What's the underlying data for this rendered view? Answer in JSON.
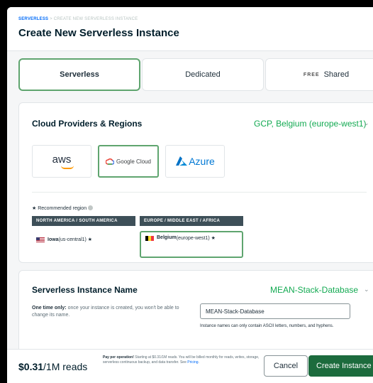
{
  "breadcrumb": {
    "parent": "SERVERLESS",
    "separator": " > ",
    "current": "CREATE NEW SERVERLESS INSTANCE"
  },
  "page_title": "Create New Serverless Instance",
  "tabs": [
    {
      "label": "Serverless",
      "selected": true
    },
    {
      "label": "Dedicated",
      "selected": false
    },
    {
      "badge": "FREE",
      "label": "Shared",
      "selected": false
    }
  ],
  "cloud": {
    "title": "Cloud Providers & Regions",
    "summary": "GCP, Belgium (europe-west1)",
    "providers": [
      {
        "name": "aws",
        "label": "aws",
        "selected": false
      },
      {
        "name": "google-cloud",
        "label": "Google Cloud",
        "selected": true
      },
      {
        "name": "azure",
        "label": "Azure",
        "selected": false
      }
    ],
    "recommended_label": "★ Recommended region",
    "region_groups": [
      {
        "header": "NORTH AMERICA / SOUTH AMERICA",
        "region": "Iowa",
        "code": " (us-central1) ★",
        "selected": false
      },
      {
        "header": "EUROPE / MIDDLE EAST / AFRICA",
        "region": "Belgium",
        "code": " (europe-west1) ★",
        "selected": true
      }
    ]
  },
  "instance_name": {
    "title": "Serverless Instance Name",
    "summary": "MEAN-Stack-Database",
    "note_strong": "One time only:",
    "note_rest": " once your instance is created, you won't be able to change its name.",
    "value": "MEAN-Stack-Database",
    "hint": "Instance names can only contain ASCII letters, numbers, and hyphens."
  },
  "footer": {
    "price": "$0.31",
    "price_unit": "/1M reads",
    "pay_strong": "Pay per operation!",
    "pay_text": " Starting at $0.31/1M reads. You will be billed monthly for reads, writes, storage, serverless continuous backup, and data transfer. See ",
    "pay_link": "Pricing",
    "pay_end": ".",
    "cancel_label": "Cancel",
    "create_label": "Create Instance"
  },
  "colors": {
    "accent_green": "#13aa52",
    "selected_border": "#5fa56f",
    "primary_button": "#1c6b3d",
    "link": "#016bf8"
  }
}
